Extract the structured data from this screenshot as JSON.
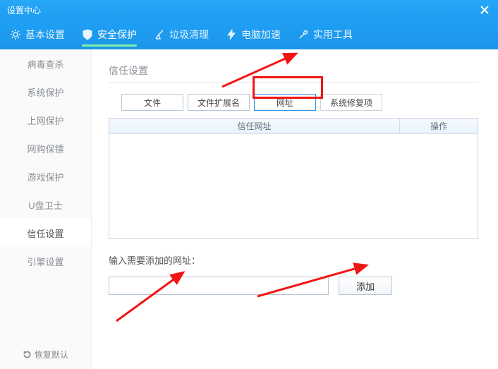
{
  "window": {
    "title": "设置中心"
  },
  "nav": {
    "items": [
      {
        "label": "基本设置"
      },
      {
        "label": "安全保护"
      },
      {
        "label": "垃圾清理"
      },
      {
        "label": "电脑加速"
      },
      {
        "label": "实用工具"
      }
    ]
  },
  "sidebar": {
    "items": [
      {
        "label": "病毒查杀"
      },
      {
        "label": "系统保护"
      },
      {
        "label": "上网保护"
      },
      {
        "label": "网购保镖"
      },
      {
        "label": "游戏保护"
      },
      {
        "label": "U盘卫士"
      },
      {
        "label": "信任设置"
      },
      {
        "label": "引擎设置"
      }
    ],
    "restore_label": "恢复默认"
  },
  "main": {
    "section_title": "信任设置",
    "tabs": [
      {
        "label": "文件"
      },
      {
        "label": "文件扩展名"
      },
      {
        "label": "网址"
      },
      {
        "label": "系统修复项"
      }
    ],
    "table": {
      "col1": "信任网址",
      "col2": "操作"
    },
    "add_label": "输入需要添加的网址：",
    "url_value": "",
    "add_btn": "添加"
  }
}
